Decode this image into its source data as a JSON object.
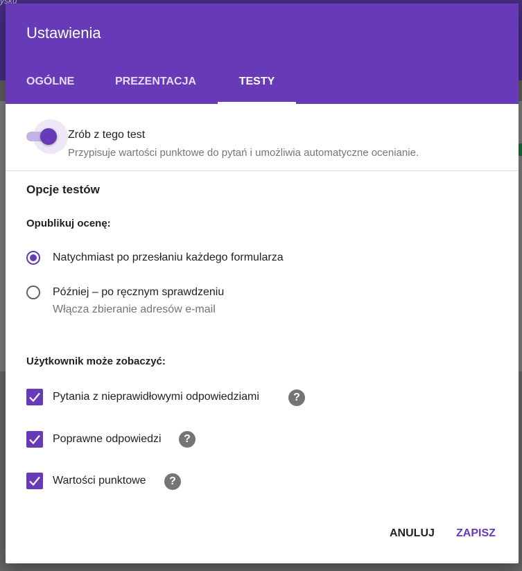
{
  "background": {
    "corner_text": "ysku"
  },
  "dialog": {
    "title": "Ustawienia",
    "tabs": [
      {
        "label": "OGÓLNE",
        "active": false
      },
      {
        "label": "PREZENTACJA",
        "active": false
      },
      {
        "label": "TESTY",
        "active": true
      }
    ]
  },
  "quiz_toggle": {
    "label": "Zrób z tego test",
    "description": "Przypisuje wartości punktowe do pytań i umożliwia automatyczne ocenianie.",
    "checked": true
  },
  "quiz_options": {
    "title": "Opcje testów",
    "release_grade": {
      "title": "Opublikuj ocenę:",
      "options": [
        {
          "label": "Natychmiast po przesłaniu każdego formularza",
          "selected": true
        },
        {
          "label": "Później – po ręcznym sprawdzeniu",
          "sublabel": "Włącza zbieranie adresów e-mail",
          "selected": false
        }
      ]
    },
    "respondent_can_see": {
      "title": "Użytkownik może zobaczyć:",
      "options": [
        {
          "label": "Pytania z nieprawidłowymi odpowiedziami",
          "checked": true
        },
        {
          "label": "Poprawne odpowiedzi",
          "checked": true
        },
        {
          "label": "Wartości punktowe",
          "checked": true
        }
      ]
    }
  },
  "icons": {
    "help": "?",
    "check": "checkmark-icon"
  },
  "actions": {
    "cancel": "ANULUJ",
    "save": "ZAPISZ"
  },
  "colors": {
    "accent": "#673ab7",
    "header": "#673ab7"
  }
}
